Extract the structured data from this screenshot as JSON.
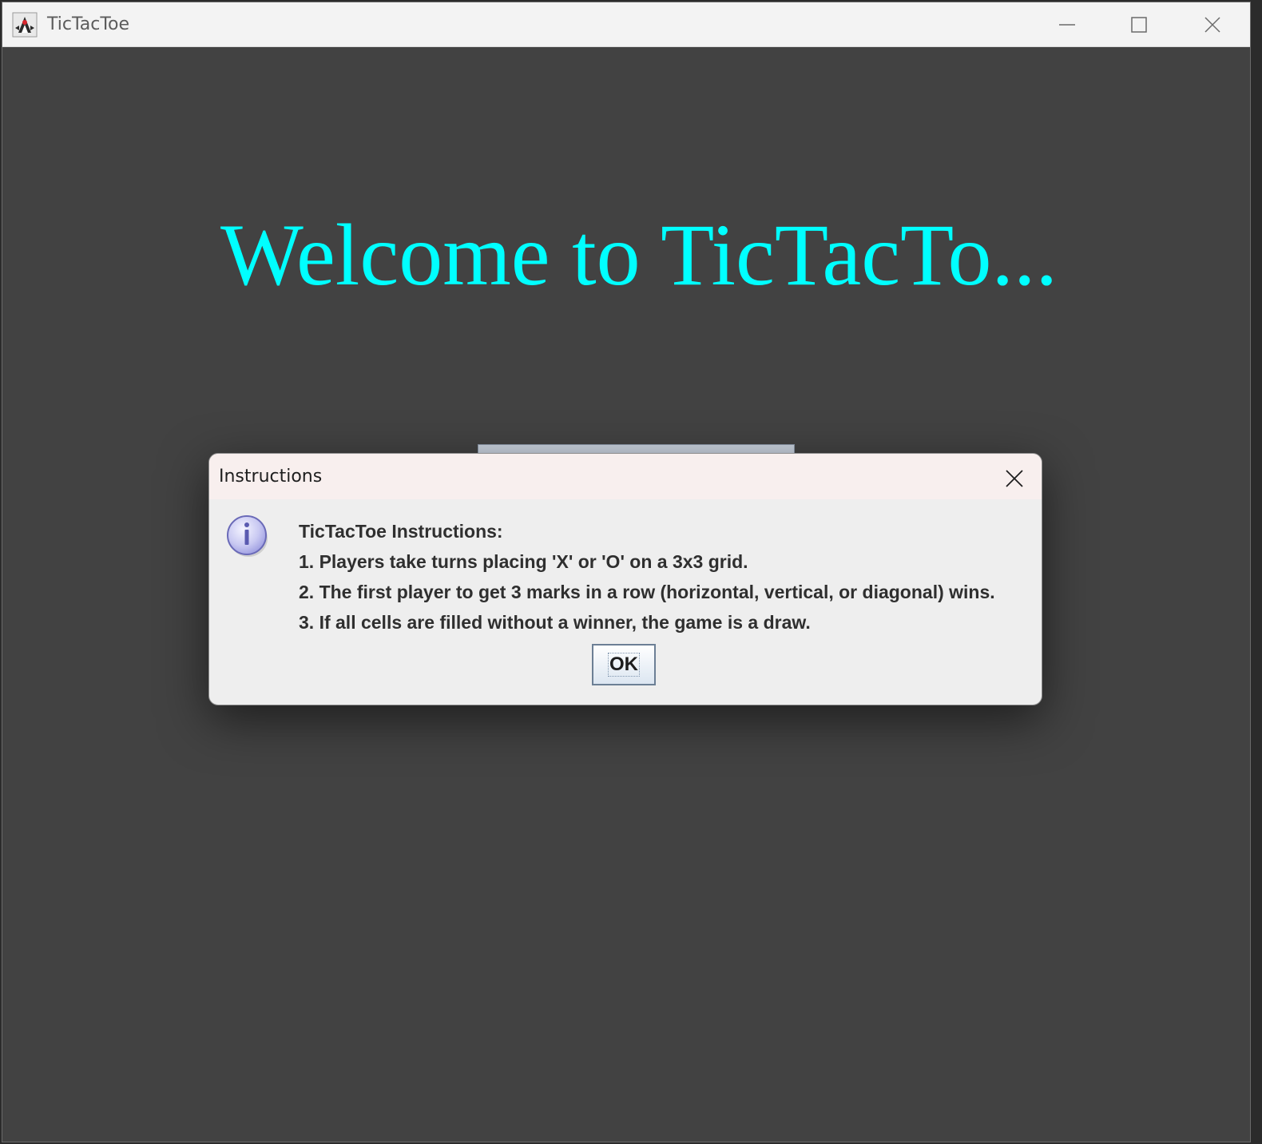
{
  "window": {
    "title": "TicTacToe",
    "icons": {
      "app": "java-duke-icon",
      "minimize": "minimize-icon",
      "maximize": "maximize-icon",
      "close": "close-icon"
    }
  },
  "main": {
    "welcome_text": "Welcome to TicTacTo...",
    "welcome_color": "#00ffff",
    "background_color": "#424242"
  },
  "dialog": {
    "title": "Instructions",
    "icon": "info-icon",
    "message_lines": [
      "TicTacToe Instructions:",
      "1. Players take turns placing 'X' or 'O' on a 3x3 grid.",
      "2. The first player to get 3 marks in a row (horizontal, vertical, or diagonal) wins.",
      "3. If all cells are filled without a winner, the game is a draw."
    ],
    "ok_label": "OK"
  }
}
